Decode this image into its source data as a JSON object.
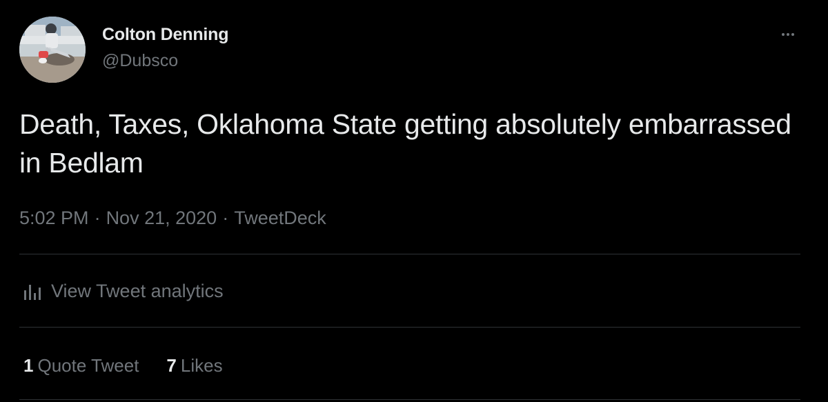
{
  "author": {
    "display_name": "Colton Denning",
    "handle": "@Dubsco",
    "avatar_icon": "profile-photo"
  },
  "tweet": {
    "text": "Death, Taxes, Oklahoma State getting absolutely embarrassed in Bedlam",
    "time": "5:02 PM",
    "date": "Nov 21, 2020",
    "separator": "·",
    "source": "TweetDeck"
  },
  "actions": {
    "more_icon": "more-horizontal-icon",
    "analytics_icon": "bar-chart-icon",
    "analytics_label": "View Tweet analytics"
  },
  "stats": {
    "quote_count": "1",
    "quote_label": "Quote Tweet",
    "like_count": "7",
    "like_label": "Likes"
  },
  "colors": {
    "background": "#000000",
    "primary_text": "#e7e9ea",
    "secondary_text": "#71767b",
    "divider": "#2f3336"
  }
}
